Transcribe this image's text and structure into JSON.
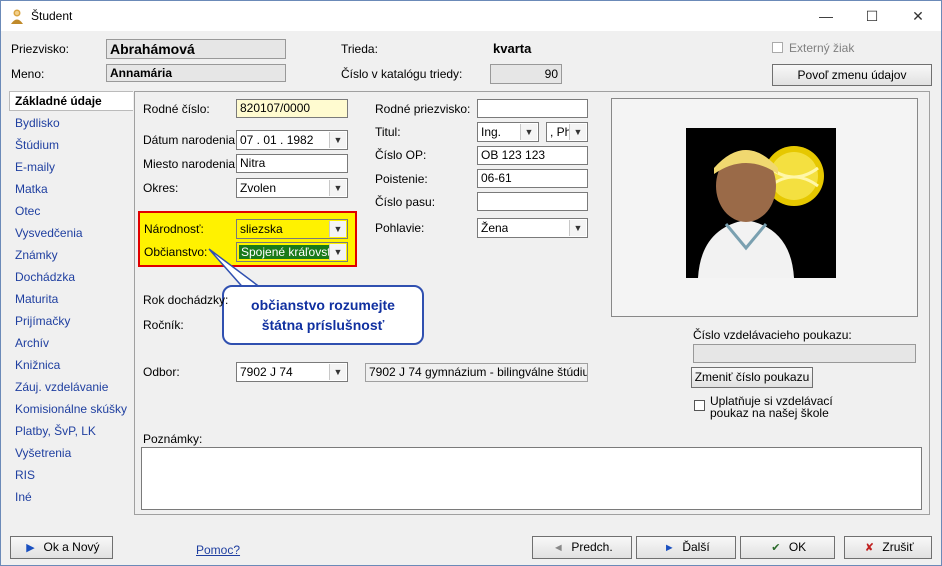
{
  "window": {
    "title": "Študent"
  },
  "header": {
    "priezvisko_label": "Priezvisko:",
    "priezvisko_value": "Abrahámová",
    "meno_label": "Meno:",
    "meno_value": "Annamária",
    "trieda_label": "Trieda:",
    "trieda_value": "kvarta",
    "cislo_katalog_label": "Číslo v katalógu triedy:",
    "cislo_katalog_value": "90",
    "externy_label": "Externý žiak",
    "povol_button": "Povoľ zmenu údajov"
  },
  "sidebar": {
    "items": [
      "Základné údaje",
      "Bydlisko",
      "Štúdium",
      "E-maily",
      "Matka",
      "Otec",
      "Vysvedčenia",
      "Známky",
      "Dochádzka",
      "Maturita",
      "Prijímačky",
      "Archív",
      "Knižnica",
      "Záuj. vzdelávanie",
      "Komisionálne skúšky",
      "Platby, ŠvP, LK",
      "Vyšetrenia",
      "RIS",
      "Iné"
    ]
  },
  "form": {
    "rodne_cislo_label": "Rodné číslo:",
    "rodne_cislo_value": "820107/0000",
    "datum_label": "Dátum narodenia:",
    "datum_value": "07 . 01 . 1982",
    "miesto_label": "Miesto narodenia:",
    "miesto_value": "Nitra",
    "okres_label": "Okres:",
    "okres_value": "Zvolen",
    "narodnost_label": "Národnosť:",
    "narodnost_value": "sliezska",
    "obcianstvo_label": "Občianstvo:",
    "obcianstvo_value": "Spojené kráľovstvo",
    "rok_dochadzky_label": "Rok dochádzky:",
    "rocnik_label": "Ročník:",
    "odbor_label": "Odbor:",
    "odbor_value": "7902 J 74",
    "odbor_desc": "7902 J 74 gymnázium - bilingválne štúdium",
    "rodne_priezvisko_label": "Rodné priezvisko:",
    "rodne_priezvisko_value": "",
    "titul_label": "Titul:",
    "titul_value": "Ing.",
    "titul2_value": ", Ph",
    "cislo_op_label": "Číslo OP:",
    "cislo_op_value": "OB 123 123",
    "poistenie_label": "Poistenie:",
    "poistenie_value": "06-61",
    "cislo_pasu_label": "Číslo pasu:",
    "cislo_pasu_value": "",
    "pohlavie_label": "Pohlavie:",
    "pohlavie_value": "Žena",
    "poukaz_label": "Číslo vzdelávacieho poukazu:",
    "poukaz_value": "",
    "zmenit_poukaz_button": "Zmeniť číslo poukazu",
    "uplatnuje_label_1": "Uplatňuje si vzdelávací",
    "uplatnuje_label_2": "poukaz na našej škole",
    "poznamky_label": "Poznámky:"
  },
  "callout": {
    "line1": "občianstvo rozumejte",
    "line2": "štátna príslušnosť"
  },
  "footer": {
    "ok_novy": "Ok a Nový",
    "pomoc": "Pomoc?",
    "predch": "Predch.",
    "dalsi": "Ďalší",
    "ok": "OK",
    "zrusit": "Zrušiť"
  },
  "colors": {
    "highlight_fill": "#fff200",
    "highlight_border": "#e00000",
    "callout_border": "#3050b0",
    "link": "#1f3fa0"
  }
}
